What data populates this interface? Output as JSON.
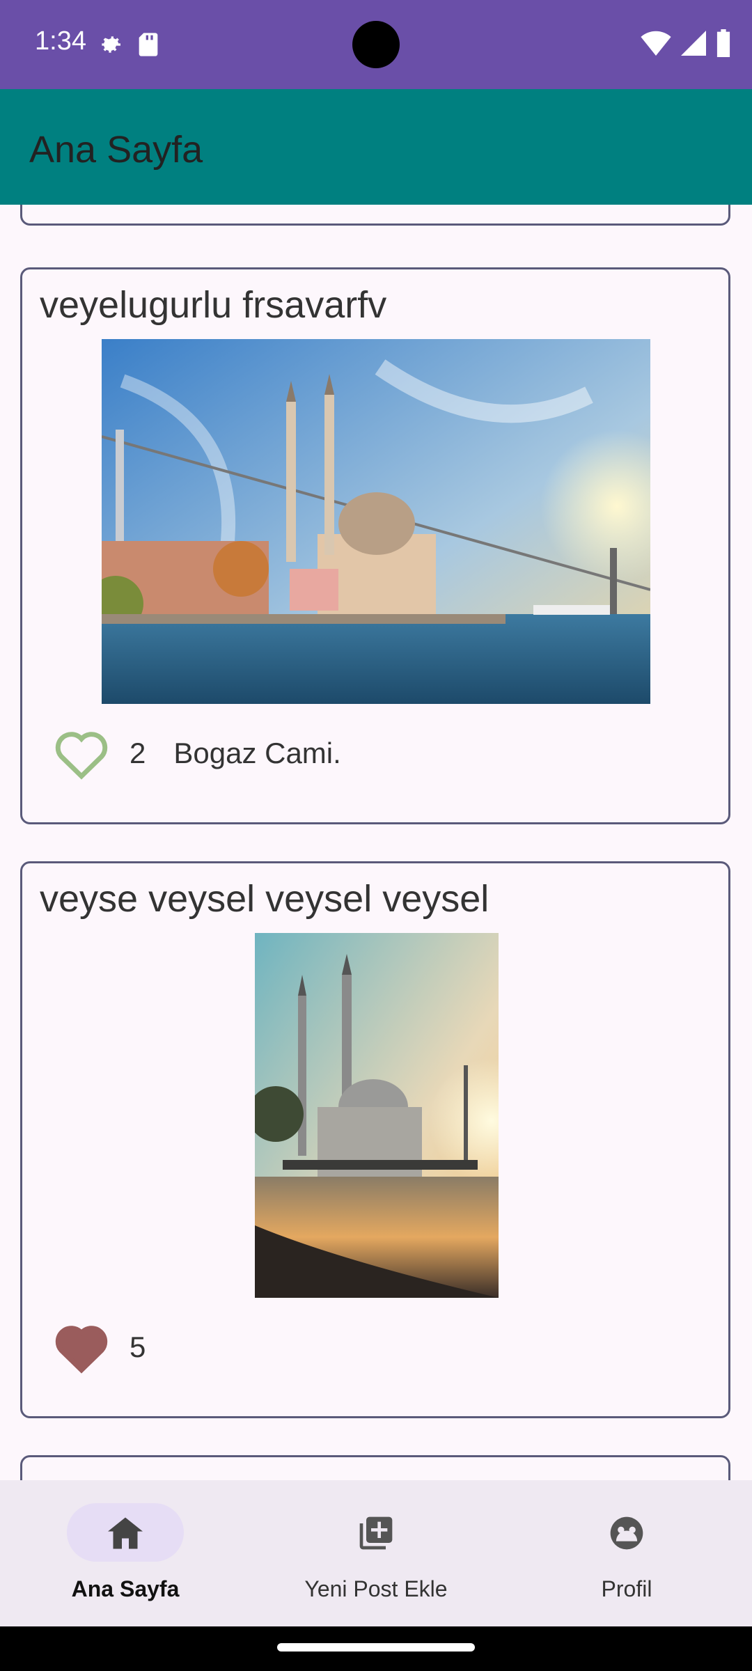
{
  "status_bar": {
    "time": "1:34",
    "icons_left": [
      "settings-icon",
      "sd-card-icon"
    ],
    "icons_right": [
      "wifi-icon",
      "signal-icon",
      "battery-icon"
    ],
    "background": "#6a4fa8"
  },
  "app_bar": {
    "title": "Ana Sayfa",
    "background": "#008080"
  },
  "posts": [
    {
      "title": "veyelugurlu frsavarfv",
      "image": "bosphorus-mosque-photo",
      "liked": false,
      "like_count": "2",
      "caption": "Bogaz Cami."
    },
    {
      "title": "veyse veysel veysel veysel",
      "image": "mosque-sunset-photo",
      "liked": true,
      "like_count": "5",
      "caption": ""
    }
  ],
  "bottom_nav": {
    "items": [
      {
        "label": "Ana Sayfa",
        "icon": "home-icon",
        "active": true
      },
      {
        "label": "Yeni Post Ekle",
        "icon": "add-post-icon",
        "active": false
      },
      {
        "label": "Profil",
        "icon": "profile-icon",
        "active": false
      }
    ]
  },
  "colors": {
    "heart_outline": "#9bbf86",
    "heart_filled": "#9a5c5c",
    "nav_active_pill": "#e6ddf5"
  }
}
